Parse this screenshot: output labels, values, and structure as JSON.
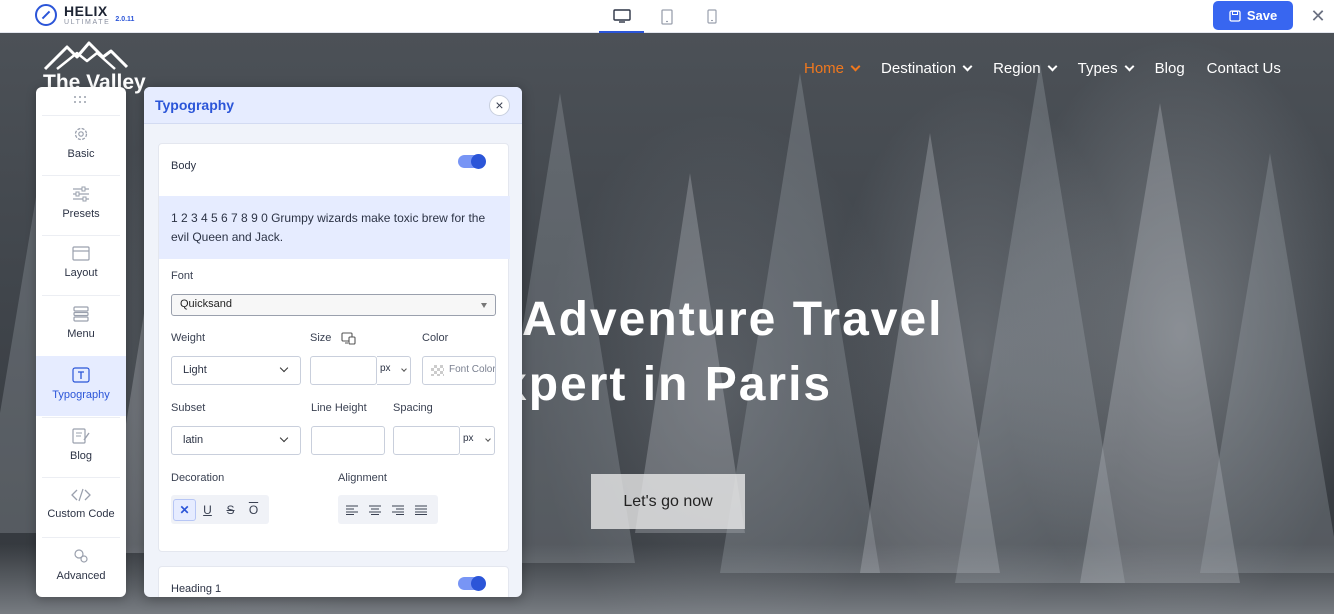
{
  "topbar": {
    "brand_name": "HELIX",
    "brand_sub": "ULTIMATE",
    "brand_version": "2.0.11",
    "devices": [
      "desktop-icon",
      "tablet-icon",
      "mobile-icon"
    ],
    "save_label": "Save",
    "close_label": "✕"
  },
  "site": {
    "logo_text": "The Valley",
    "nav": [
      {
        "label": "Home",
        "dropdown": true,
        "active": true
      },
      {
        "label": "Destination",
        "dropdown": true
      },
      {
        "label": "Region",
        "dropdown": true
      },
      {
        "label": "Types",
        "dropdown": true
      },
      {
        "label": "Blog",
        "dropdown": false
      },
      {
        "label": "Contact Us",
        "dropdown": false
      }
    ],
    "hero_title_line1": "Adventure Travel",
    "hero_title_line2": "xpert in Paris",
    "hero_button": "Let's go now"
  },
  "sidebar": {
    "items": [
      {
        "label": "Basic",
        "icon": "gear-icon"
      },
      {
        "label": "Presets",
        "icon": "sliders-icon"
      },
      {
        "label": "Layout",
        "icon": "layout-icon"
      },
      {
        "label": "Menu",
        "icon": "menu-icon"
      },
      {
        "label": "Typography",
        "icon": "typography-icon",
        "active": true
      },
      {
        "label": "Blog",
        "icon": "blog-icon"
      },
      {
        "label": "Custom Code",
        "icon": "code-icon"
      },
      {
        "label": "Advanced",
        "icon": "advanced-icon"
      }
    ]
  },
  "panel": {
    "title": "Typography",
    "close_label": "×",
    "body": {
      "label": "Body",
      "enabled": true,
      "preview": "1 2 3 4 5 6 7 8 9 0 Grumpy wizards make toxic brew for the evil Queen and Jack.",
      "font_label": "Font",
      "font_value": "Quicksand",
      "weight_label": "Weight",
      "weight_value": "Light",
      "size_label": "Size",
      "size_unit": "px",
      "color_label": "Color",
      "color_placeholder": "Font Color",
      "subset_label": "Subset",
      "subset_value": "latin",
      "line_height_label": "Line Height",
      "spacing_label": "Spacing",
      "spacing_unit": "px",
      "decoration_label": "Decoration",
      "alignment_label": "Alignment",
      "decoration_buttons": [
        "none",
        "underline",
        "strikethrough",
        "overline"
      ],
      "alignment_buttons": [
        "left",
        "center",
        "right",
        "justify"
      ]
    },
    "heading1": {
      "label": "Heading 1",
      "enabled": true
    }
  }
}
